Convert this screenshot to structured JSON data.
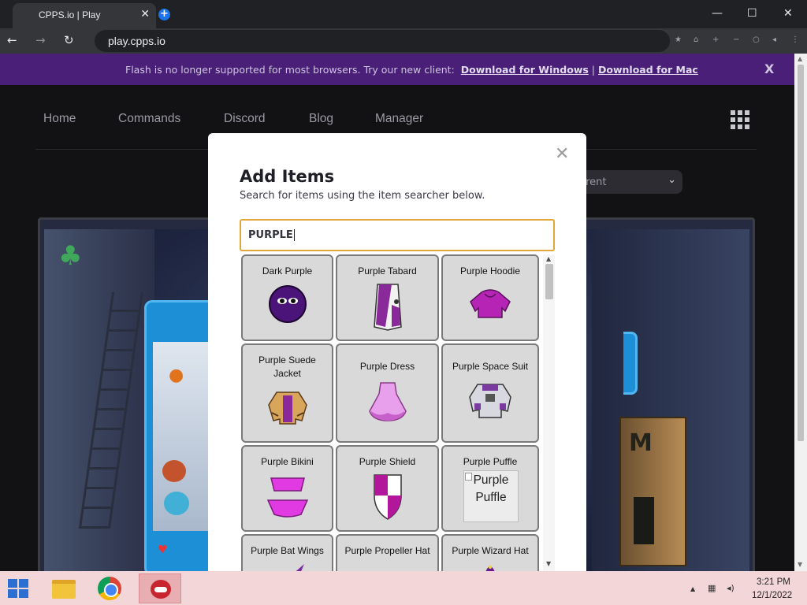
{
  "browser": {
    "tab_title": "CPPS.io | Play",
    "tab_close": "✕",
    "new_tab": "+",
    "minimize": "—",
    "maximize": "☐",
    "close": "✕",
    "back": "←",
    "forward": "→",
    "reload": "↻",
    "url": "play.cpps.io",
    "extension_icons": [
      "star-icon",
      "home-icon",
      "plus-icon",
      "minus-icon",
      "circle-icon",
      "speaker-icon",
      "menu-icon"
    ]
  },
  "banner": {
    "text": "Flash is no longer supported for most browsers. Try our new client:",
    "link_windows": "Download for Windows",
    "separator": "|",
    "link_mac": "Download for Mac",
    "close": "X"
  },
  "site_nav": {
    "items": [
      "Home",
      "Commands",
      "Discord",
      "Blog",
      "Manager"
    ],
    "select_value": "rrent",
    "select_arrow": "⌄"
  },
  "modal": {
    "close": "✕",
    "title": "Add Items",
    "subtitle": "Search for items using the item searcher below.",
    "search_value": "PURPLE",
    "items": [
      {
        "name": "Dark Purple",
        "icon": "dark-purple-puffle-icon",
        "color": "#5a1a8c"
      },
      {
        "name": "Purple Tabard",
        "icon": "purple-tabard-icon",
        "color": "#8a2a9a"
      },
      {
        "name": "Purple Hoodie",
        "icon": "purple-hoodie-icon",
        "color": "#b524b5"
      },
      {
        "name": "Purple Suede Jacket",
        "icon": "purple-suede-jacket-icon",
        "color": "#c98a3a"
      },
      {
        "name": "Purple Dress",
        "icon": "purple-dress-icon",
        "color": "#e07ae0"
      },
      {
        "name": "Purple Space Suit",
        "icon": "purple-space-suit-icon",
        "color": "#8a7aa0"
      },
      {
        "name": "Purple Bikini",
        "icon": "purple-bikini-icon",
        "color": "#e23ae2"
      },
      {
        "name": "Purple Shield",
        "icon": "purple-shield-icon",
        "color": "#b2169a"
      },
      {
        "name": "Purple Puffle",
        "icon": "broken-image-icon",
        "alt": "Purple Puffle"
      },
      {
        "name": "Purple Bat Wings",
        "icon": "purple-bat-wings-icon",
        "color": "#7a2aa0"
      },
      {
        "name": "Purple Propeller Hat",
        "icon": "purple-propeller-hat-icon",
        "color": "#9a2ab0"
      },
      {
        "name": "Purple Wizard Hat",
        "icon": "purple-wizard-hat-icon",
        "color": "#6a1a90"
      }
    ]
  },
  "taskbar": {
    "apps": [
      "file-explorer-icon",
      "chrome-icon",
      "game-client-icon"
    ],
    "tray_arrow": "▲",
    "time": "3:21 PM",
    "date": "12/1/2022"
  },
  "colors": {
    "banner_bg": "#4a1f78",
    "search_border": "#e2a63a",
    "page_bg": "#121214",
    "taskbar_bg": "#f3d6d8"
  }
}
